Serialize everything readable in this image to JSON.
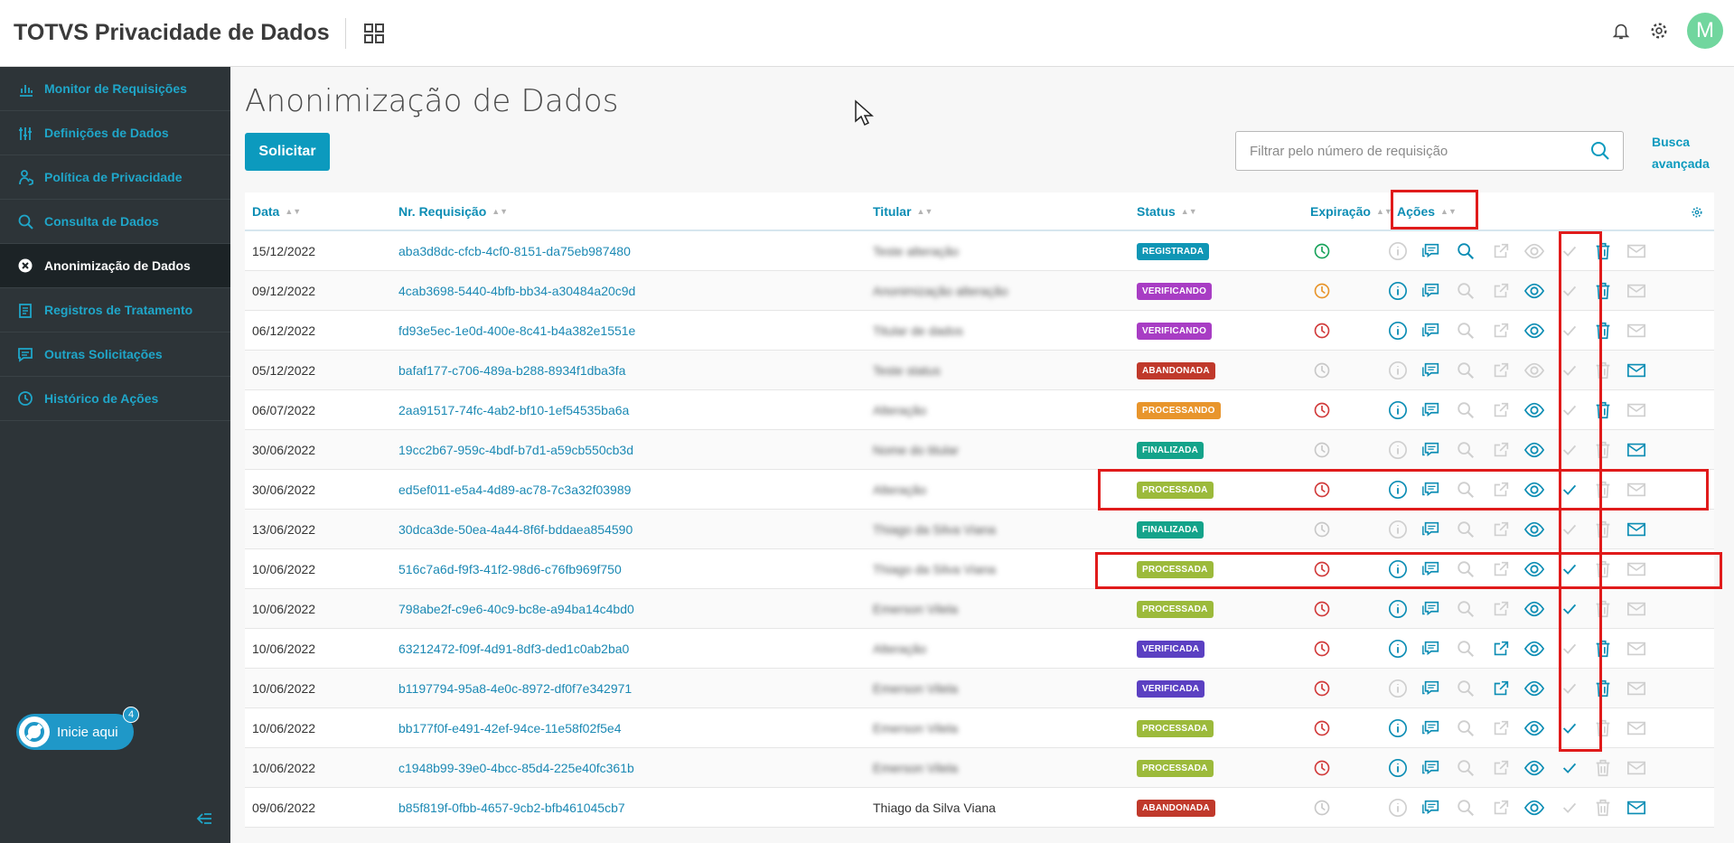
{
  "app": {
    "title": "TOTVS Privacidade de Dados",
    "avatar_letter": "M"
  },
  "sidebar": {
    "items": [
      {
        "label": "Monitor de Requisições",
        "icon": "chart-bar-icon",
        "active": false
      },
      {
        "label": "Definições de Dados",
        "icon": "sliders-icon",
        "active": false
      },
      {
        "label": "Política de Privacidade",
        "icon": "person-shield-icon",
        "active": false
      },
      {
        "label": "Consulta de Dados",
        "icon": "search-icon",
        "active": false
      },
      {
        "label": "Anonimização de Dados",
        "icon": "anonymize-icon",
        "active": true
      },
      {
        "label": "Registros de Tratamento",
        "icon": "records-icon",
        "active": false
      },
      {
        "label": "Outras Solicitações",
        "icon": "chat-icon",
        "active": false
      },
      {
        "label": "Histórico de Ações",
        "icon": "history-icon",
        "active": false
      }
    ],
    "help": {
      "label": "Inicie aqui",
      "badge": "4"
    }
  },
  "main": {
    "title": "Anonimização de Dados",
    "request_button": "Solicitar",
    "search_placeholder": "Filtrar pelo número de requisição",
    "advanced_search": "Busca avançada"
  },
  "table": {
    "columns": [
      "Data",
      "Nr. Requisição",
      "Titular",
      "Status",
      "Expiração",
      "Ações"
    ],
    "rows": [
      {
        "date": "15/12/2022",
        "req": "aba3d8dc-cfcb-4cf0-8151-da75eb987480",
        "titular": "Teste alteração",
        "titular_blurred": true,
        "status": "REGISTRADA",
        "exp": "green",
        "info": false,
        "search": true,
        "ext": false,
        "view": false,
        "check": false,
        "del": true,
        "mail": false
      },
      {
        "date": "09/12/2022",
        "req": "4cab3698-5440-4bfb-bb34-a30484a20c9d",
        "titular": "Anonimização alteração",
        "titular_blurred": true,
        "status": "VERIFICANDO",
        "exp": "orange",
        "info": true,
        "search": false,
        "ext": false,
        "view": true,
        "check": false,
        "del": true,
        "mail": false
      },
      {
        "date": "06/12/2022",
        "req": "fd93e5ec-1e0d-400e-8c41-b4a382e1551e",
        "titular": "Titular de dados",
        "titular_blurred": true,
        "status": "VERIFICANDO",
        "exp": "red",
        "info": true,
        "search": false,
        "ext": false,
        "view": true,
        "check": false,
        "del": true,
        "mail": false
      },
      {
        "date": "05/12/2022",
        "req": "bafaf177-c706-489a-b288-8934f1dba3fa",
        "titular": "Teste status",
        "titular_blurred": true,
        "status": "ABANDONADA",
        "exp": "gray",
        "info": false,
        "search": false,
        "ext": false,
        "view": false,
        "check": false,
        "del": false,
        "mail": true
      },
      {
        "date": "06/07/2022",
        "req": "2aa91517-74fc-4ab2-bf10-1ef54535ba6a",
        "titular": "Alteração",
        "titular_blurred": true,
        "status": "PROCESSANDO",
        "exp": "red",
        "info": true,
        "search": false,
        "ext": false,
        "view": true,
        "check": false,
        "del": true,
        "mail": false
      },
      {
        "date": "30/06/2022",
        "req": "19cc2b67-959c-4bdf-b7d1-a59cb550cb3d",
        "titular": "Nome do titular",
        "titular_blurred": true,
        "status": "FINALIZADA",
        "exp": "gray",
        "info": false,
        "search": false,
        "ext": false,
        "view": true,
        "check": false,
        "del": false,
        "mail": true
      },
      {
        "date": "30/06/2022",
        "req": "ed5ef011-e5a4-4d89-ac78-7c3a32f03989",
        "titular": "Alteração",
        "titular_blurred": true,
        "status": "PROCESSADA",
        "exp": "red",
        "info": true,
        "search": false,
        "ext": false,
        "view": true,
        "check": true,
        "del": false,
        "mail": false
      },
      {
        "date": "13/06/2022",
        "req": "30dca3de-50ea-4a44-8f6f-bddaea854590",
        "titular": "Thiago da Silva Viana",
        "titular_blurred": true,
        "status": "FINALIZADA",
        "exp": "gray",
        "info": false,
        "search": false,
        "ext": false,
        "view": true,
        "check": false,
        "del": false,
        "mail": true
      },
      {
        "date": "10/06/2022",
        "req": "516c7a6d-f9f3-41f2-98d6-c76fb969f750",
        "titular": "Thiago da Silva Viana",
        "titular_blurred": true,
        "status": "PROCESSADA",
        "exp": "red",
        "info": true,
        "search": false,
        "ext": false,
        "view": true,
        "check": true,
        "del": false,
        "mail": false
      },
      {
        "date": "10/06/2022",
        "req": "798abe2f-c9e6-40c9-bc8e-a94ba14c4bd0",
        "titular": "Emerson Vilela",
        "titular_blurred": true,
        "status": "PROCESSADA",
        "exp": "red",
        "info": true,
        "search": false,
        "ext": false,
        "view": true,
        "check": true,
        "del": false,
        "mail": false
      },
      {
        "date": "10/06/2022",
        "req": "63212472-f09f-4d91-8df3-ded1c0ab2ba0",
        "titular": "Alteração",
        "titular_blurred": true,
        "status": "VERIFICADA",
        "exp": "red",
        "info": true,
        "search": false,
        "ext": true,
        "view": true,
        "check": false,
        "del": true,
        "mail": false
      },
      {
        "date": "10/06/2022",
        "req": "b1197794-95a8-4e0c-8972-df0f7e342971",
        "titular": "Emerson Vilela",
        "titular_blurred": true,
        "status": "VERIFICADA",
        "exp": "red",
        "info": false,
        "search": false,
        "ext": true,
        "view": true,
        "check": false,
        "del": true,
        "mail": false
      },
      {
        "date": "10/06/2022",
        "req": "bb177f0f-e491-42ef-94ce-11e58f02f5e4",
        "titular": "Emerson Vilela",
        "titular_blurred": true,
        "status": "PROCESSADA",
        "exp": "red",
        "info": true,
        "search": false,
        "ext": false,
        "view": true,
        "check": true,
        "del": false,
        "mail": false
      },
      {
        "date": "10/06/2022",
        "req": "c1948b99-39e0-4bcc-85d4-225e40fc361b",
        "titular": "Emerson Vilela",
        "titular_blurred": true,
        "status": "PROCESSADA",
        "exp": "red",
        "info": true,
        "search": false,
        "ext": false,
        "view": true,
        "check": true,
        "del": false,
        "mail": false
      },
      {
        "date": "09/06/2022",
        "req": "b85f819f-0fbb-4657-9cb2-bfb461045cb7",
        "titular": "Thiago da Silva Viana",
        "titular_blurred": false,
        "status": "ABANDONADA",
        "exp": "gray",
        "info": false,
        "search": false,
        "ext": false,
        "view": true,
        "check": false,
        "del": false,
        "mail": true
      }
    ]
  },
  "colors": {
    "accent": "#0c9abe",
    "REGISTRADA": "#0f96b5",
    "VERIFICANDO": "#a83dc4",
    "ABANDONADA": "#c0392b",
    "PROCESSANDO": "#e8952c",
    "FINALIZADA": "#14a38a",
    "PROCESSADA": "#9cba3b",
    "VERIFICADA": "#5b40c2",
    "exp_green": "#1aa35c",
    "exp_orange": "#e8952c",
    "exp_red": "#d13b3b",
    "exp_gray": "#c8c8c8",
    "highlight": "#e01b1b"
  }
}
